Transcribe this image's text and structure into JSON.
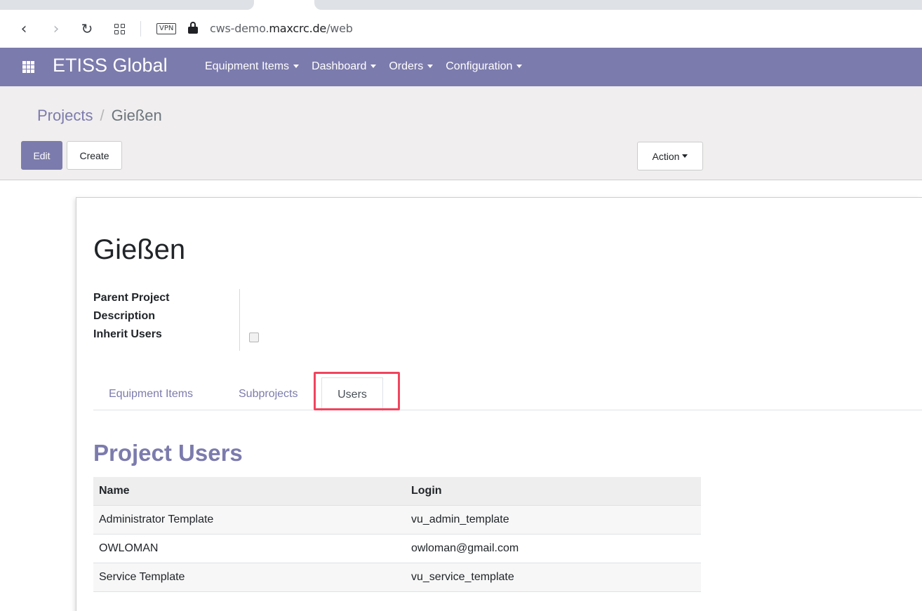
{
  "browser": {
    "url_prefix": "cws-demo.",
    "url_host": "maxcrc.de",
    "url_path": "/web",
    "vpn_label": "VPN"
  },
  "navbar": {
    "brand": "ETISS Global",
    "menu": [
      {
        "label": "Equipment Items"
      },
      {
        "label": "Dashboard"
      },
      {
        "label": "Orders"
      },
      {
        "label": "Configuration"
      }
    ],
    "background": "#7c7bad"
  },
  "control_panel": {
    "breadcrumb": {
      "parent": "Projects",
      "separator": "/",
      "current": "Gießen"
    },
    "edit_label": "Edit",
    "create_label": "Create",
    "action_label": "Action"
  },
  "record": {
    "title": "Gießen",
    "fields": {
      "parent_project": "Parent Project",
      "description": "Description",
      "inherit_users": "Inherit Users"
    },
    "inherit_users_checked": false
  },
  "tabs": [
    {
      "label": "Equipment Items",
      "active": false
    },
    {
      "label": "Subprojects",
      "active": false
    },
    {
      "label": "Users",
      "active": true
    }
  ],
  "users_section": {
    "title": "Project Users",
    "columns": [
      "Name",
      "Login"
    ],
    "rows": [
      {
        "name": "Administrator Template",
        "login": "vu_admin_template"
      },
      {
        "name": "OWLOMAN",
        "login": "owloman@gmail.com"
      },
      {
        "name": "Service Template",
        "login": "vu_service_template"
      }
    ]
  },
  "colors": {
    "accent": "#7c7bad",
    "highlight": "#f1445e"
  }
}
